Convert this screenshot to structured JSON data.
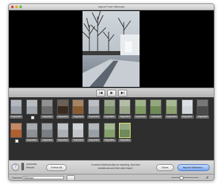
{
  "window": {
    "title": "Import From Webcam"
  },
  "playback": {
    "prev": "|◀",
    "play": "▶",
    "next": "▶|"
  },
  "clips_row1": [
    {
      "label": "Imported",
      "imported": true,
      "bg": "#9b9fa8"
    },
    {
      "label": "",
      "imported": false,
      "bg": "#a0a6ad"
    },
    {
      "label": "Imported",
      "imported": true,
      "bg": "#6d6d6d"
    },
    {
      "label": "Imported",
      "imported": true,
      "bg": "#3a2a1e"
    },
    {
      "label": "Imported",
      "imported": true,
      "bg": "#8a5a30"
    },
    {
      "label": "Imported",
      "imported": true,
      "bg": "#a4a9ae"
    },
    {
      "label": "Imported",
      "imported": true,
      "bg": "#7b8d68"
    },
    {
      "label": "Imported",
      "imported": true,
      "bg": "#9aa78a"
    },
    {
      "label": "Imported",
      "imported": true,
      "bg": "#7f9a62"
    },
    {
      "label": "Imported",
      "imported": true,
      "bg": "#6e8a55"
    },
    {
      "label": "Imported",
      "imported": true,
      "bg": "#8ba06f"
    },
    {
      "label": "Imported",
      "imported": true,
      "bg": "#cfd5da"
    },
    {
      "label": "Imported",
      "imported": true,
      "bg": "#4a4a4a"
    }
  ],
  "clips_row2": [
    {
      "label": "",
      "imported": false,
      "bg": "#b06030"
    },
    {
      "label": "Imported",
      "imported": true,
      "bg": "#8d9196"
    },
    {
      "label": "Imported",
      "imported": true,
      "bg": "#7a7e84"
    },
    {
      "label": "Imported",
      "imported": true,
      "bg": "#aab0b6"
    },
    {
      "label": "Imported",
      "imported": true,
      "bg": "#c2c6ca"
    },
    {
      "label": "Imported",
      "imported": true,
      "bg": "#9aa0a6"
    },
    {
      "label": "Imported",
      "imported": true,
      "bg": "#86a06a"
    },
    {
      "label": "Imported",
      "imported": true,
      "bg": "#6f8a5a",
      "selected": true
    }
  ],
  "bottom": {
    "help": "?",
    "mode_top": "Automatic",
    "mode_bottom": "Manual",
    "check_all": "Check All",
    "instructions": "To select individual clips for importing, click their checkboxes and then click Import.",
    "done": "Done",
    "import_selected": "Import Selected..."
  },
  "status": {
    "camera_label": "Camera:",
    "camera_value": "Webcam",
    "resize": "◢"
  }
}
